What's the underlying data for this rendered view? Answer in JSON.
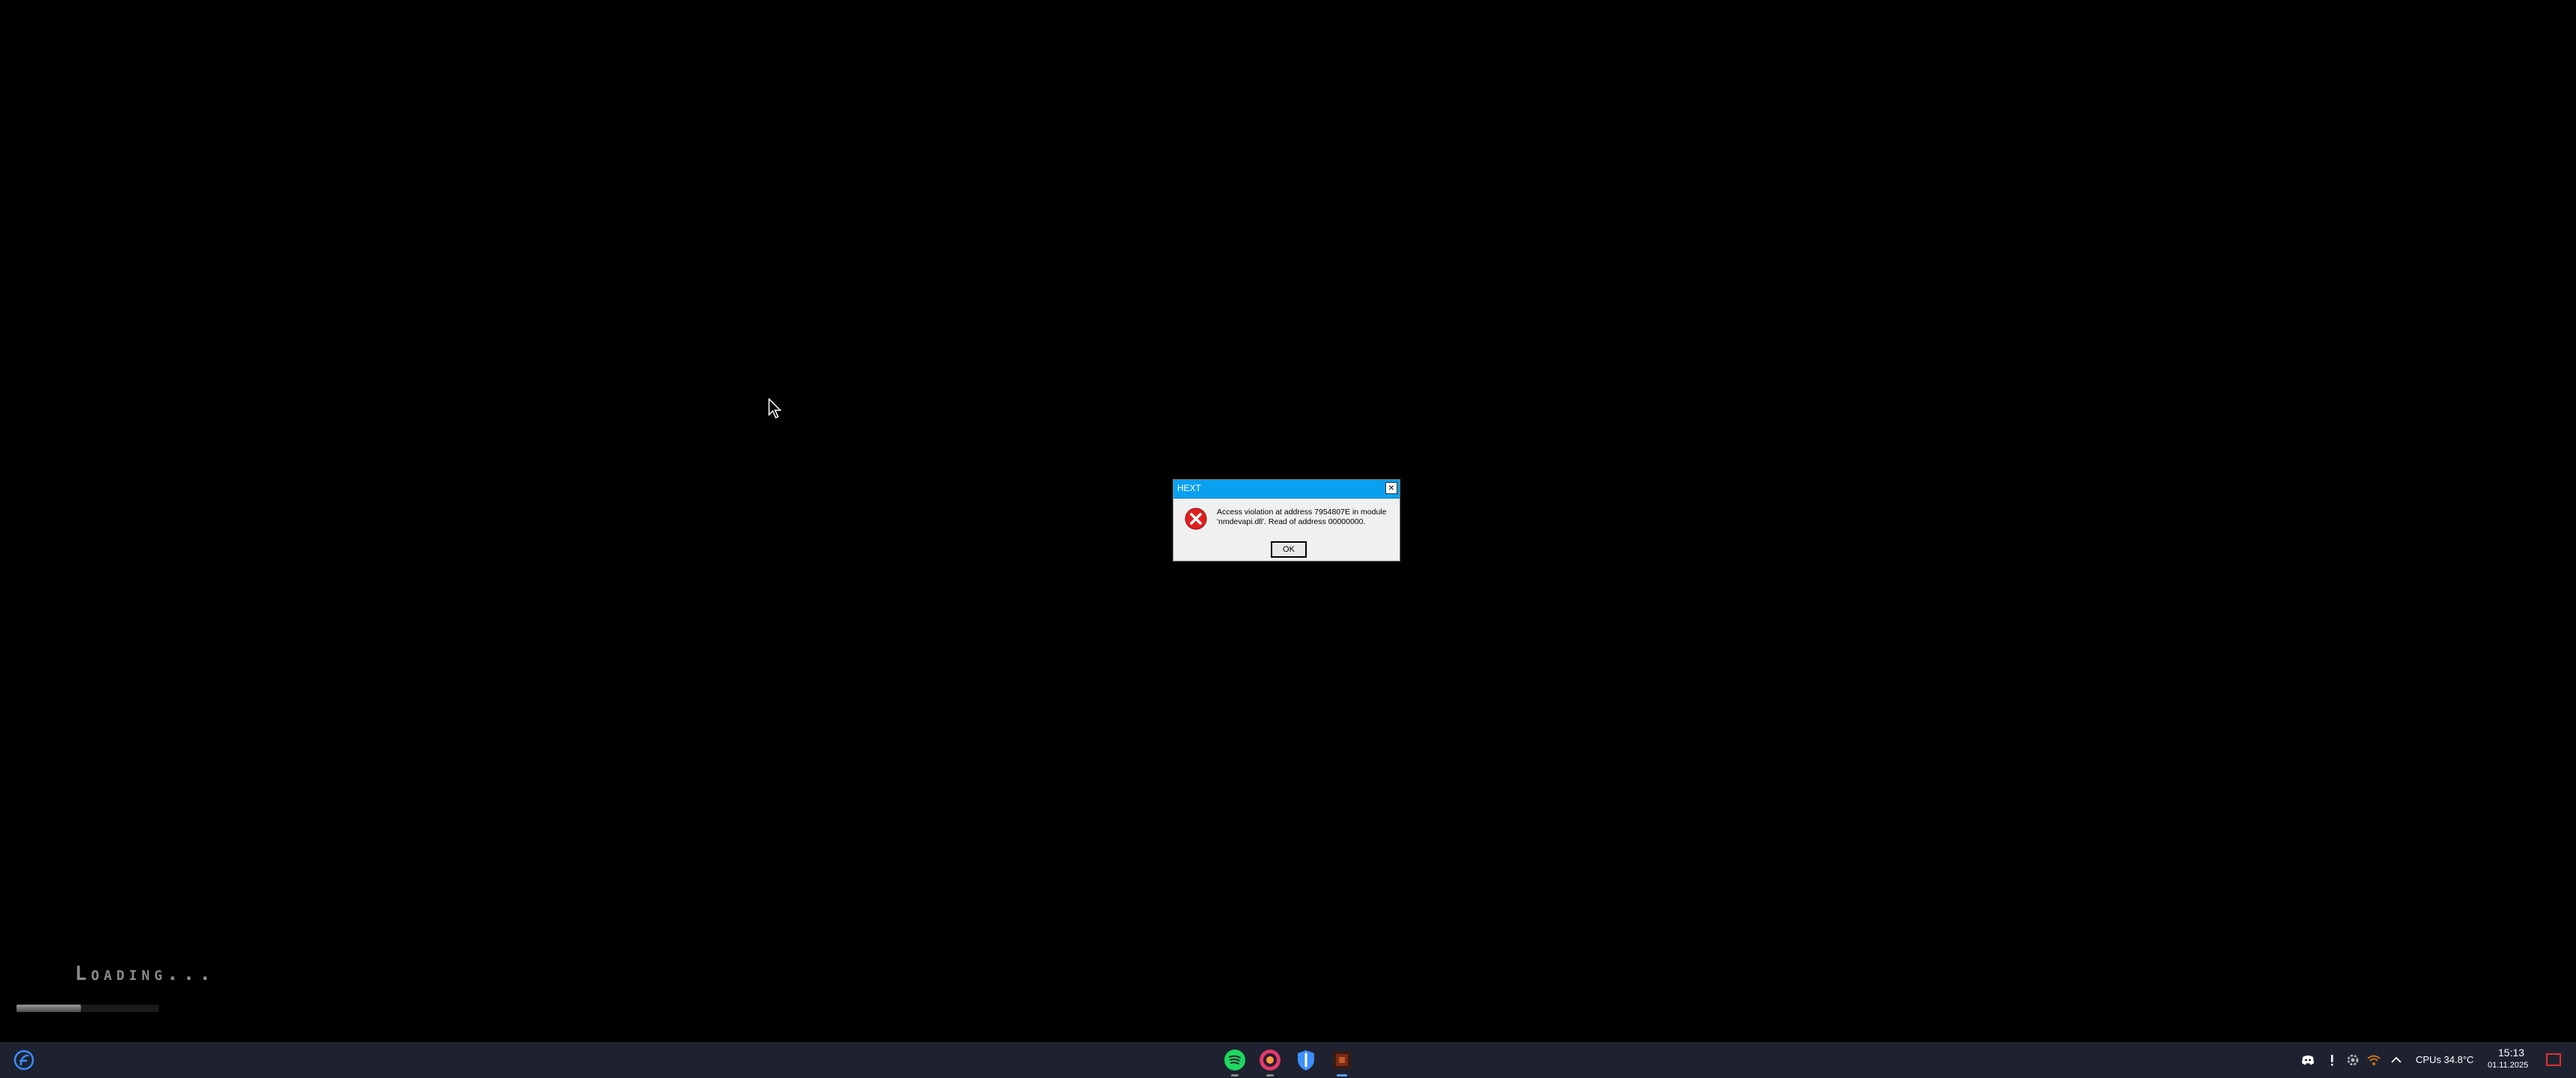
{
  "loading": {
    "text": "Loading...",
    "progress_fraction": 0.45
  },
  "dialog": {
    "title": "HEXT",
    "close_glyph": "×",
    "message": "Access violation at address 7954807E in module 'nmdevapi.dll'. Read of address 00000000.",
    "ok_label": "OK",
    "icon": "error-icon"
  },
  "taskbar": {
    "start_icon": "start-logo-icon",
    "apps": [
      {
        "name": "spotify-icon",
        "color": "#1ed760"
      },
      {
        "name": "browser-icon",
        "color": "#e03a6a"
      },
      {
        "name": "shield-app-icon",
        "color": "#3d8fff"
      },
      {
        "name": "game-app-icon",
        "color": "#7a2a1a"
      }
    ],
    "tray": {
      "cpu_temp": "CPUs 34.8°C",
      "time": "15:13",
      "date": "01.11.2025"
    }
  },
  "colors": {
    "dialog_titlebar": "#0aa0f0",
    "taskbar_bg": "#1e2230",
    "error_red": "#e02020"
  }
}
